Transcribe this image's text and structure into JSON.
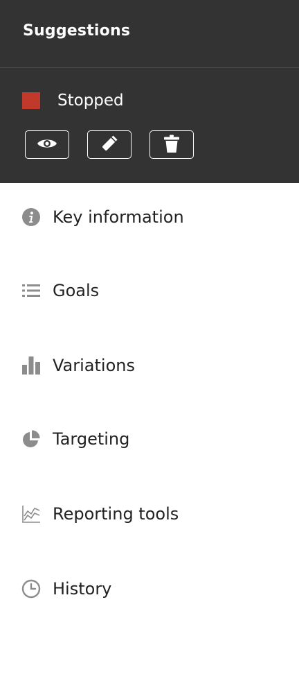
{
  "panel": {
    "title": "Suggestions"
  },
  "status": {
    "label": "Stopped",
    "color": "#c0392b"
  },
  "actions": [
    {
      "icon": "eye-icon"
    },
    {
      "icon": "pencil-icon"
    },
    {
      "icon": "trash-icon"
    }
  ],
  "nav": {
    "items": [
      {
        "label": "Key information",
        "icon": "info-icon"
      },
      {
        "label": "Goals",
        "icon": "list-icon"
      },
      {
        "label": "Variations",
        "icon": "bar-chart-icon"
      },
      {
        "label": "Targeting",
        "icon": "pie-chart-icon"
      },
      {
        "label": "Reporting tools",
        "icon": "line-chart-icon"
      },
      {
        "label": "History",
        "icon": "clock-icon"
      }
    ]
  },
  "colors": {
    "header_bg": "#333333",
    "icon_gray": "#8c8c8c",
    "text": "#222222"
  }
}
